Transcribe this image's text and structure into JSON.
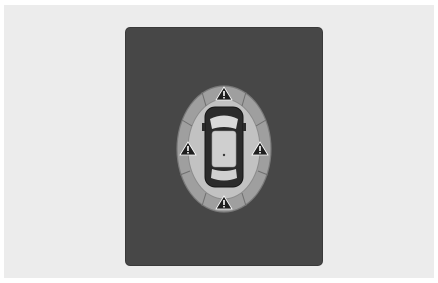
{
  "display": {
    "screen_color": "#474747",
    "frame_color": "#ececec",
    "zone_color": "#b3b3b3",
    "zone_outline_color": "#8c8c8c",
    "vehicle_color": "#1f1f1f"
  },
  "parking_sensor_view": {
    "mode": "all-sensors-warning",
    "zones": [
      {
        "name": "front-center",
        "warning_icon": "warning-triangle-icon"
      },
      {
        "name": "front-left"
      },
      {
        "name": "front-right"
      },
      {
        "name": "side-left",
        "warning_icon": "warning-triangle-icon"
      },
      {
        "name": "side-right",
        "warning_icon": "warning-triangle-icon"
      },
      {
        "name": "rear-left"
      },
      {
        "name": "rear-right"
      },
      {
        "name": "rear-center",
        "warning_icon": "warning-triangle-icon"
      }
    ]
  }
}
